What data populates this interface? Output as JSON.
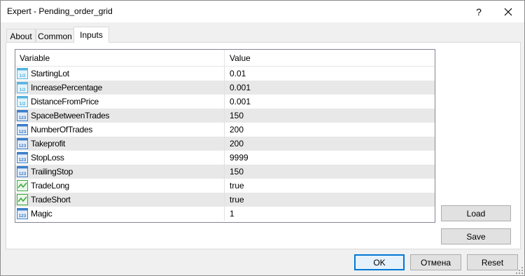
{
  "window": {
    "title": "Expert - Pending_order_grid",
    "help_label": "?"
  },
  "tabs": [
    {
      "label": "About",
      "active": false
    },
    {
      "label": "Common",
      "active": false
    },
    {
      "label": "Inputs",
      "active": true
    }
  ],
  "grid": {
    "headers": {
      "variable": "Variable",
      "value": "Value"
    },
    "rows": [
      {
        "name": "StartingLot",
        "value": "0.01",
        "icon": "double-type-icon"
      },
      {
        "name": "IncreasePercentage",
        "value": "0.001",
        "icon": "double-type-icon"
      },
      {
        "name": "DistanceFromPrice",
        "value": "0.001",
        "icon": "double-type-icon"
      },
      {
        "name": "SpaceBetweenTrades",
        "value": "150",
        "icon": "integer-type-icon"
      },
      {
        "name": "NumberOfTrades",
        "value": "200",
        "icon": "integer-type-icon"
      },
      {
        "name": "Takeprofit",
        "value": "200",
        "icon": "integer-type-icon"
      },
      {
        "name": "StopLoss",
        "value": "9999",
        "icon": "integer-type-icon"
      },
      {
        "name": "TrailingStop",
        "value": "150",
        "icon": "integer-type-icon"
      },
      {
        "name": "TradeLong",
        "value": "true",
        "icon": "boolean-type-icon"
      },
      {
        "name": "TradeShort",
        "value": "true",
        "icon": "boolean-type-icon"
      },
      {
        "name": "Magic",
        "value": "1",
        "icon": "integer-type-icon"
      }
    ]
  },
  "side_buttons": {
    "load": "Load",
    "save": "Save"
  },
  "footer": {
    "ok": "OK",
    "cancel": "Отмена",
    "reset": "Reset"
  },
  "icon_labels": {
    "double": "1/2",
    "integer": "123"
  },
  "colors": {
    "double_icon": "#56b4e0",
    "integer_icon": "#3d7ec9",
    "boolean_icon": "#3ea83e",
    "ok_border": "#0078d7"
  }
}
